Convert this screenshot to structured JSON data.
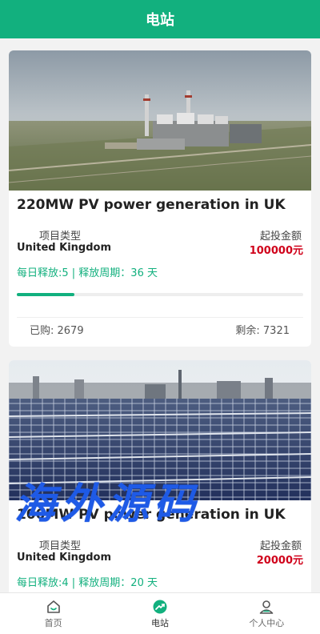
{
  "header": {
    "title": "电站"
  },
  "cards": [
    {
      "title": "220MW PV power generation in UK",
      "type_label": "项目类型",
      "type_value": "United Kingdom",
      "min_label": "起投金额",
      "min_value": "100000元",
      "release": "每日释放:5 | 释放周期：36 天",
      "progress_fraction": 0.2,
      "bought": "已购: 2679",
      "remaining": "剩余: 7321"
    },
    {
      "title": "100MW PV power generation in UK",
      "type_label": "项目类型",
      "type_value": "United Kingdom",
      "min_label": "起投金额",
      "min_value": "20000元",
      "release": "每日释放:4 | 释放周期：20 天"
    }
  ],
  "watermark": "海外源码",
  "tabbar": {
    "items": [
      {
        "label": "首页",
        "icon": "home-icon"
      },
      {
        "label": "电站",
        "icon": "station-icon",
        "active": true
      },
      {
        "label": "个人中心",
        "icon": "user-icon"
      }
    ]
  },
  "colors": {
    "brand": "#12b07e",
    "price": "#d0021b",
    "watermark": "#1e5ae6"
  }
}
